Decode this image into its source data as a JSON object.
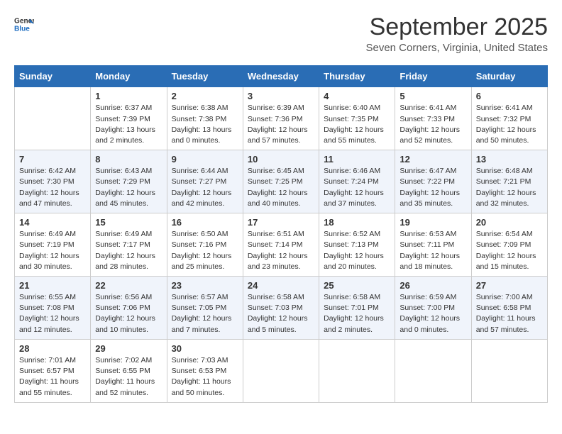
{
  "logo": {
    "general": "General",
    "blue": "Blue"
  },
  "title": "September 2025",
  "subtitle": "Seven Corners, Virginia, United States",
  "days_of_week": [
    "Sunday",
    "Monday",
    "Tuesday",
    "Wednesday",
    "Thursday",
    "Friday",
    "Saturday"
  ],
  "weeks": [
    [
      {
        "day": "",
        "sunrise": "",
        "sunset": "",
        "daylight": ""
      },
      {
        "day": "1",
        "sunrise": "Sunrise: 6:37 AM",
        "sunset": "Sunset: 7:39 PM",
        "daylight": "Daylight: 13 hours and 2 minutes."
      },
      {
        "day": "2",
        "sunrise": "Sunrise: 6:38 AM",
        "sunset": "Sunset: 7:38 PM",
        "daylight": "Daylight: 13 hours and 0 minutes."
      },
      {
        "day": "3",
        "sunrise": "Sunrise: 6:39 AM",
        "sunset": "Sunset: 7:36 PM",
        "daylight": "Daylight: 12 hours and 57 minutes."
      },
      {
        "day": "4",
        "sunrise": "Sunrise: 6:40 AM",
        "sunset": "Sunset: 7:35 PM",
        "daylight": "Daylight: 12 hours and 55 minutes."
      },
      {
        "day": "5",
        "sunrise": "Sunrise: 6:41 AM",
        "sunset": "Sunset: 7:33 PM",
        "daylight": "Daylight: 12 hours and 52 minutes."
      },
      {
        "day": "6",
        "sunrise": "Sunrise: 6:41 AM",
        "sunset": "Sunset: 7:32 PM",
        "daylight": "Daylight: 12 hours and 50 minutes."
      }
    ],
    [
      {
        "day": "7",
        "sunrise": "Sunrise: 6:42 AM",
        "sunset": "Sunset: 7:30 PM",
        "daylight": "Daylight: 12 hours and 47 minutes."
      },
      {
        "day": "8",
        "sunrise": "Sunrise: 6:43 AM",
        "sunset": "Sunset: 7:29 PM",
        "daylight": "Daylight: 12 hours and 45 minutes."
      },
      {
        "day": "9",
        "sunrise": "Sunrise: 6:44 AM",
        "sunset": "Sunset: 7:27 PM",
        "daylight": "Daylight: 12 hours and 42 minutes."
      },
      {
        "day": "10",
        "sunrise": "Sunrise: 6:45 AM",
        "sunset": "Sunset: 7:25 PM",
        "daylight": "Daylight: 12 hours and 40 minutes."
      },
      {
        "day": "11",
        "sunrise": "Sunrise: 6:46 AM",
        "sunset": "Sunset: 7:24 PM",
        "daylight": "Daylight: 12 hours and 37 minutes."
      },
      {
        "day": "12",
        "sunrise": "Sunrise: 6:47 AM",
        "sunset": "Sunset: 7:22 PM",
        "daylight": "Daylight: 12 hours and 35 minutes."
      },
      {
        "day": "13",
        "sunrise": "Sunrise: 6:48 AM",
        "sunset": "Sunset: 7:21 PM",
        "daylight": "Daylight: 12 hours and 32 minutes."
      }
    ],
    [
      {
        "day": "14",
        "sunrise": "Sunrise: 6:49 AM",
        "sunset": "Sunset: 7:19 PM",
        "daylight": "Daylight: 12 hours and 30 minutes."
      },
      {
        "day": "15",
        "sunrise": "Sunrise: 6:49 AM",
        "sunset": "Sunset: 7:17 PM",
        "daylight": "Daylight: 12 hours and 28 minutes."
      },
      {
        "day": "16",
        "sunrise": "Sunrise: 6:50 AM",
        "sunset": "Sunset: 7:16 PM",
        "daylight": "Daylight: 12 hours and 25 minutes."
      },
      {
        "day": "17",
        "sunrise": "Sunrise: 6:51 AM",
        "sunset": "Sunset: 7:14 PM",
        "daylight": "Daylight: 12 hours and 23 minutes."
      },
      {
        "day": "18",
        "sunrise": "Sunrise: 6:52 AM",
        "sunset": "Sunset: 7:13 PM",
        "daylight": "Daylight: 12 hours and 20 minutes."
      },
      {
        "day": "19",
        "sunrise": "Sunrise: 6:53 AM",
        "sunset": "Sunset: 7:11 PM",
        "daylight": "Daylight: 12 hours and 18 minutes."
      },
      {
        "day": "20",
        "sunrise": "Sunrise: 6:54 AM",
        "sunset": "Sunset: 7:09 PM",
        "daylight": "Daylight: 12 hours and 15 minutes."
      }
    ],
    [
      {
        "day": "21",
        "sunrise": "Sunrise: 6:55 AM",
        "sunset": "Sunset: 7:08 PM",
        "daylight": "Daylight: 12 hours and 12 minutes."
      },
      {
        "day": "22",
        "sunrise": "Sunrise: 6:56 AM",
        "sunset": "Sunset: 7:06 PM",
        "daylight": "Daylight: 12 hours and 10 minutes."
      },
      {
        "day": "23",
        "sunrise": "Sunrise: 6:57 AM",
        "sunset": "Sunset: 7:05 PM",
        "daylight": "Daylight: 12 hours and 7 minutes."
      },
      {
        "day": "24",
        "sunrise": "Sunrise: 6:58 AM",
        "sunset": "Sunset: 7:03 PM",
        "daylight": "Daylight: 12 hours and 5 minutes."
      },
      {
        "day": "25",
        "sunrise": "Sunrise: 6:58 AM",
        "sunset": "Sunset: 7:01 PM",
        "daylight": "Daylight: 12 hours and 2 minutes."
      },
      {
        "day": "26",
        "sunrise": "Sunrise: 6:59 AM",
        "sunset": "Sunset: 7:00 PM",
        "daylight": "Daylight: 12 hours and 0 minutes."
      },
      {
        "day": "27",
        "sunrise": "Sunrise: 7:00 AM",
        "sunset": "Sunset: 6:58 PM",
        "daylight": "Daylight: 11 hours and 57 minutes."
      }
    ],
    [
      {
        "day": "28",
        "sunrise": "Sunrise: 7:01 AM",
        "sunset": "Sunset: 6:57 PM",
        "daylight": "Daylight: 11 hours and 55 minutes."
      },
      {
        "day": "29",
        "sunrise": "Sunrise: 7:02 AM",
        "sunset": "Sunset: 6:55 PM",
        "daylight": "Daylight: 11 hours and 52 minutes."
      },
      {
        "day": "30",
        "sunrise": "Sunrise: 7:03 AM",
        "sunset": "Sunset: 6:53 PM",
        "daylight": "Daylight: 11 hours and 50 minutes."
      },
      {
        "day": "",
        "sunrise": "",
        "sunset": "",
        "daylight": ""
      },
      {
        "day": "",
        "sunrise": "",
        "sunset": "",
        "daylight": ""
      },
      {
        "day": "",
        "sunrise": "",
        "sunset": "",
        "daylight": ""
      },
      {
        "day": "",
        "sunrise": "",
        "sunset": "",
        "daylight": ""
      }
    ]
  ]
}
